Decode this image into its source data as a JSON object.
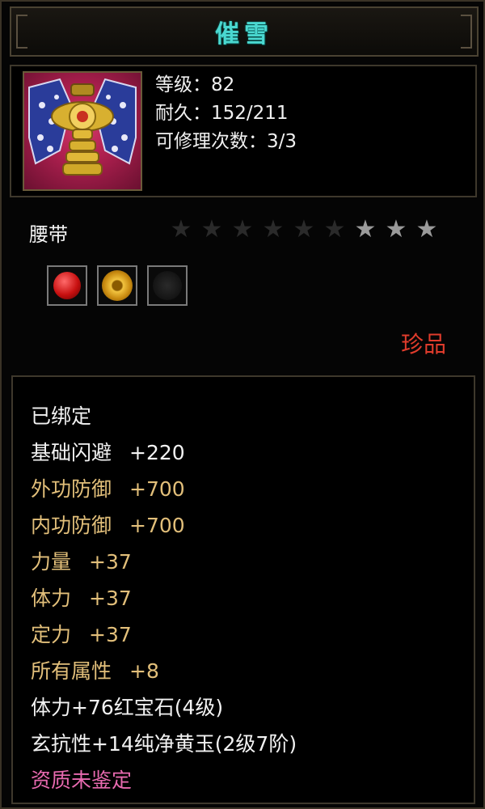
{
  "item": {
    "name": "催雪",
    "level_line": "等级：82",
    "durability_line": "耐久：152/211",
    "repair_line": "可修理次数：3/3",
    "type": "腰带",
    "rarity": "珍品",
    "stars_total": 9,
    "stars_lit": 3,
    "gems": [
      {
        "kind": "ruby",
        "icon": "red-gem-icon"
      },
      {
        "kind": "yellow-jade",
        "icon": "gold-gem-icon"
      },
      {
        "kind": "empty",
        "icon": "empty-slot-icon"
      }
    ]
  },
  "attributes": {
    "bound": "已绑定",
    "rows": [
      {
        "name": "基础闪避",
        "value": "+220",
        "color": "#f2f2f2"
      },
      {
        "name": "外功防御",
        "value": "+700",
        "color": "#e2bf7a"
      },
      {
        "name": "内功防御",
        "value": "+700",
        "color": "#e2bf7a"
      },
      {
        "name": "力量",
        "value": "+37",
        "color": "#e2bf7a"
      },
      {
        "name": "体力",
        "value": "+37",
        "color": "#e2bf7a"
      },
      {
        "name": "定力",
        "value": "+37",
        "color": "#e2bf7a"
      },
      {
        "name": "所有属性",
        "value": "+8",
        "color": "#e2bf7a"
      }
    ],
    "gem_line_1": "体力+76红宝石(4级)",
    "gem_line_2": "玄抗性+14纯净黄玉(2级7阶)",
    "quality_line": "资质未鉴定"
  },
  "colors": {
    "title": "#4ad8d0",
    "rarity": "#e03c2c",
    "quality": "#e86ab0"
  }
}
